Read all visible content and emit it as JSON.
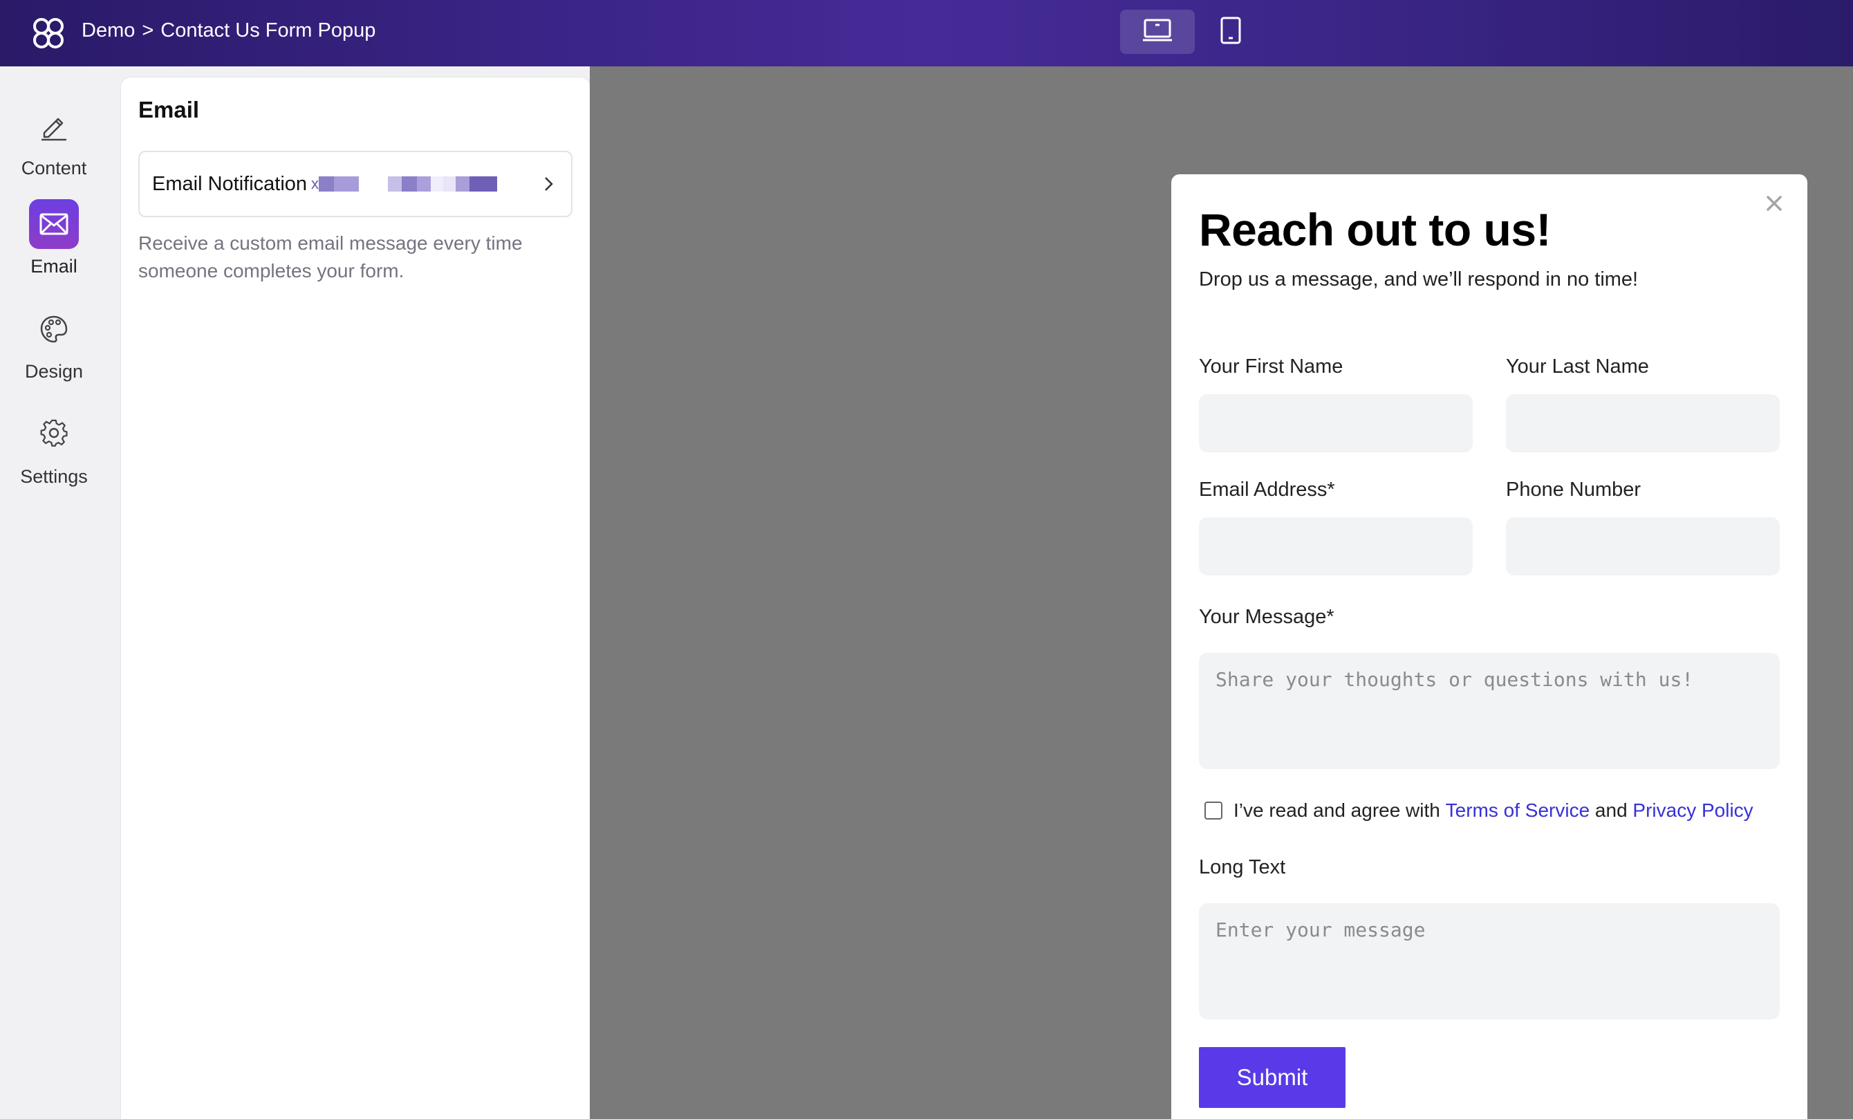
{
  "header": {
    "breadcrumb_root": "Demo",
    "breadcrumb_sep": ">",
    "breadcrumb_current": "Contact Us Form Popup",
    "logo_icon": "clover-logo-icon",
    "devices": [
      {
        "name": "desktop",
        "icon": "laptop-icon",
        "active": true
      },
      {
        "name": "tablet",
        "icon": "tablet-icon",
        "active": false
      }
    ]
  },
  "sidebar": {
    "items": [
      {
        "label": "Content",
        "icon": "pencil-icon",
        "active": false
      },
      {
        "label": "Email",
        "icon": "mail-icon",
        "active": true
      },
      {
        "label": "Design",
        "icon": "palette-icon",
        "active": false
      },
      {
        "label": "Settings",
        "icon": "gear-icon",
        "active": false
      }
    ]
  },
  "panel": {
    "title": "Email",
    "notification_label": "Email Notification",
    "notification_email_prefix": "x",
    "description": "Receive a custom email message every time someone completes your form."
  },
  "popup": {
    "title": "Reach out to us!",
    "subtitle": "Drop us a message, and we’ll respond in no time!",
    "fields": {
      "first_name": "Your First Name",
      "last_name": "Your Last Name",
      "email": "Email Address*",
      "phone": "Phone Number",
      "message": "Your Message*",
      "message_placeholder": "Share your thoughts or questions with us!",
      "long_text": "Long Text",
      "long_text_placeholder": "Enter your message"
    },
    "consent": {
      "prefix": "I’ve read and agree with",
      "terms": "Terms of Service",
      "and": "and",
      "privacy": "Privacy Policy",
      "checked": false
    },
    "submit_label": "Submit"
  },
  "colors": {
    "accent": "#5a3ae8",
    "link": "#3730d8",
    "topbar": "#3b2487",
    "canvas": "#7a7a7a"
  }
}
